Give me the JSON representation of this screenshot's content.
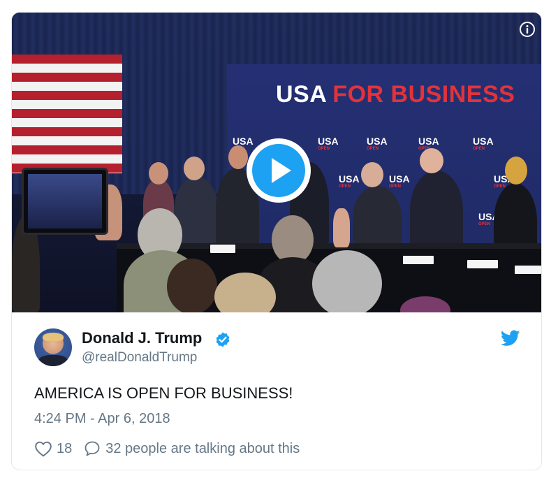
{
  "media": {
    "banner_left": "USA",
    "banner_right": "FOR BUSINESS",
    "banner_open": "OPEN",
    "mini_logo": "USA",
    "play_icon": "play-icon",
    "info_icon": "info-icon"
  },
  "tweet": {
    "author_name": "Donald J. Trump",
    "author_handle": "@realDonaldTrump",
    "verified_icon": "verified-badge-icon",
    "platform_icon": "twitter-bird-icon",
    "text": "AMERICA IS OPEN FOR BUSINESS!",
    "timestamp": "4:24 PM - Apr 6, 2018",
    "like_count": "18",
    "talking_text": "32 people are talking about this"
  },
  "colors": {
    "accent": "#1da1f2",
    "text_primary": "#14171a",
    "text_secondary": "#657786",
    "border": "#e1e8ed",
    "banner_red": "#e2333a"
  }
}
